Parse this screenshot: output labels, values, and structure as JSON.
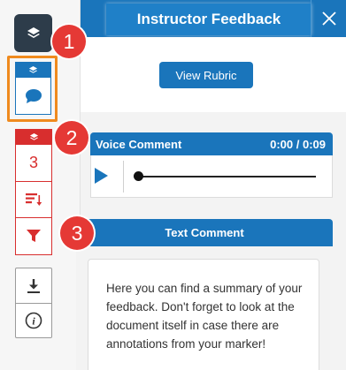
{
  "header": {
    "title": "Instructor Feedback",
    "close_icon": "close-icon"
  },
  "actions": {
    "view_rubric_label": "View Rubric"
  },
  "rail": {
    "top_icon": "layers-icon",
    "feedback_card": {
      "header_icon": "layers-icon",
      "body_icon": "speech-bubble-icon"
    },
    "annotation_card": {
      "header_icon": "layers-icon",
      "count": "3",
      "sort_icon": "sort-icon",
      "filter_icon": "filter-icon"
    },
    "tools": {
      "download_icon": "download-icon",
      "info_icon": "info-icon"
    }
  },
  "badges": [
    "1",
    "2",
    "3"
  ],
  "voice_comment": {
    "label": "Voice Comment",
    "time": "0:00 / 0:09",
    "progress": 0
  },
  "text_comment": {
    "label": "Text Comment",
    "body": "Here you can find a summary of your feedback. Don't forget to look at the document itself in case there are annotations from your marker!"
  },
  "colors": {
    "primary": "#1a75bb",
    "danger": "#d82e2e",
    "highlight": "#ef8a1e",
    "badge": "#e53935",
    "rail_dark": "#2d3c4a"
  }
}
